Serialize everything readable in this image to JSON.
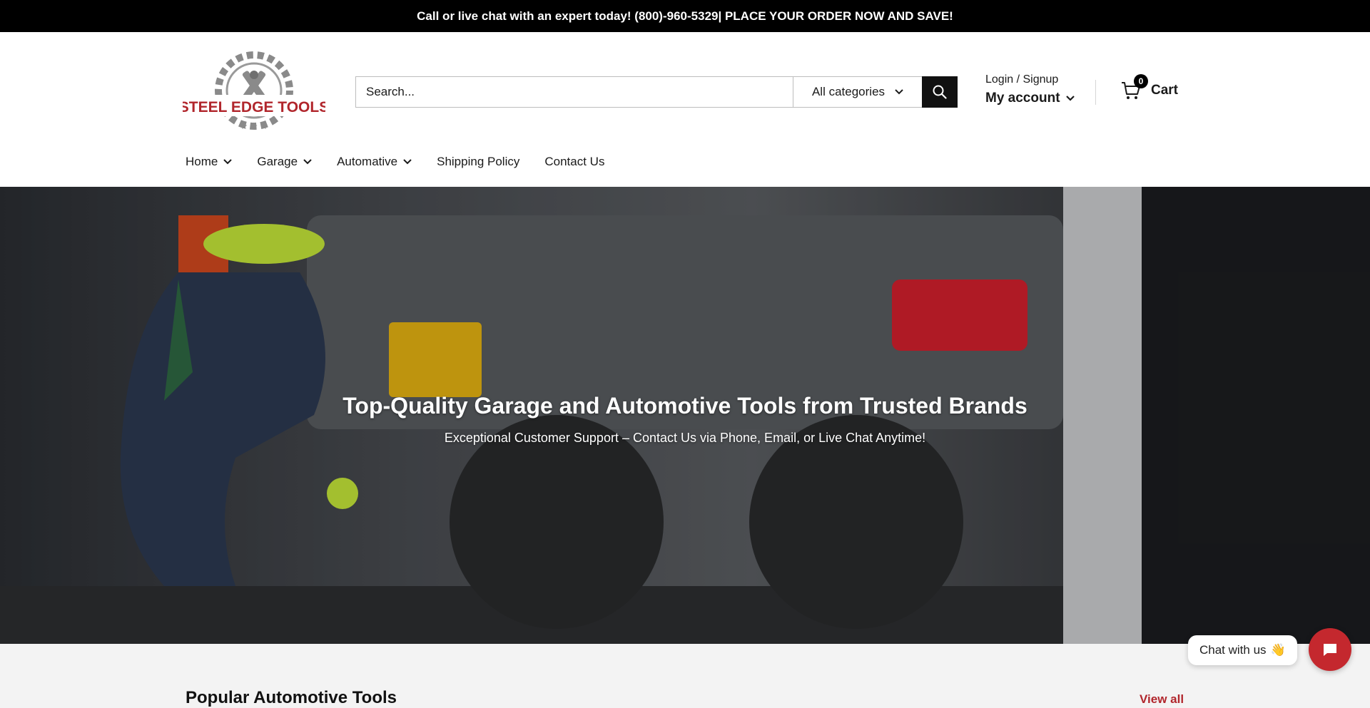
{
  "announcement": {
    "text": "Call or live chat with an expert today! (800)-960-5329| PLACE YOUR ORDER NOW AND SAVE!"
  },
  "header": {
    "logo_text": "STEEL EDGE TOOLS",
    "search": {
      "placeholder": "Search...",
      "category": "All categories",
      "icon": "search-icon"
    },
    "account": {
      "login_label": "Login / Signup",
      "account_label": "My account"
    },
    "cart": {
      "count": "0",
      "label": "Cart",
      "icon": "cart-icon"
    }
  },
  "nav": {
    "items": [
      {
        "label": "Home"
      },
      {
        "label": "Garage"
      },
      {
        "label": "Automative"
      },
      {
        "label": "Shipping Policy"
      },
      {
        "label": "Contact Us"
      }
    ]
  },
  "hero": {
    "title": "Top-Quality Garage and Automotive Tools from Trusted Brands",
    "subtitle": "Exceptional Customer Support – Contact Us via Phone, Email, or Live Chat Anytime!"
  },
  "section": {
    "title": "Popular Automotive Tools",
    "view_all": "View all"
  },
  "chat": {
    "label": "Chat with us",
    "emoji": "👋"
  },
  "colors": {
    "accent": "#b1262c",
    "chat_button": "#c4282e",
    "announcement_bg": "#000000"
  }
}
